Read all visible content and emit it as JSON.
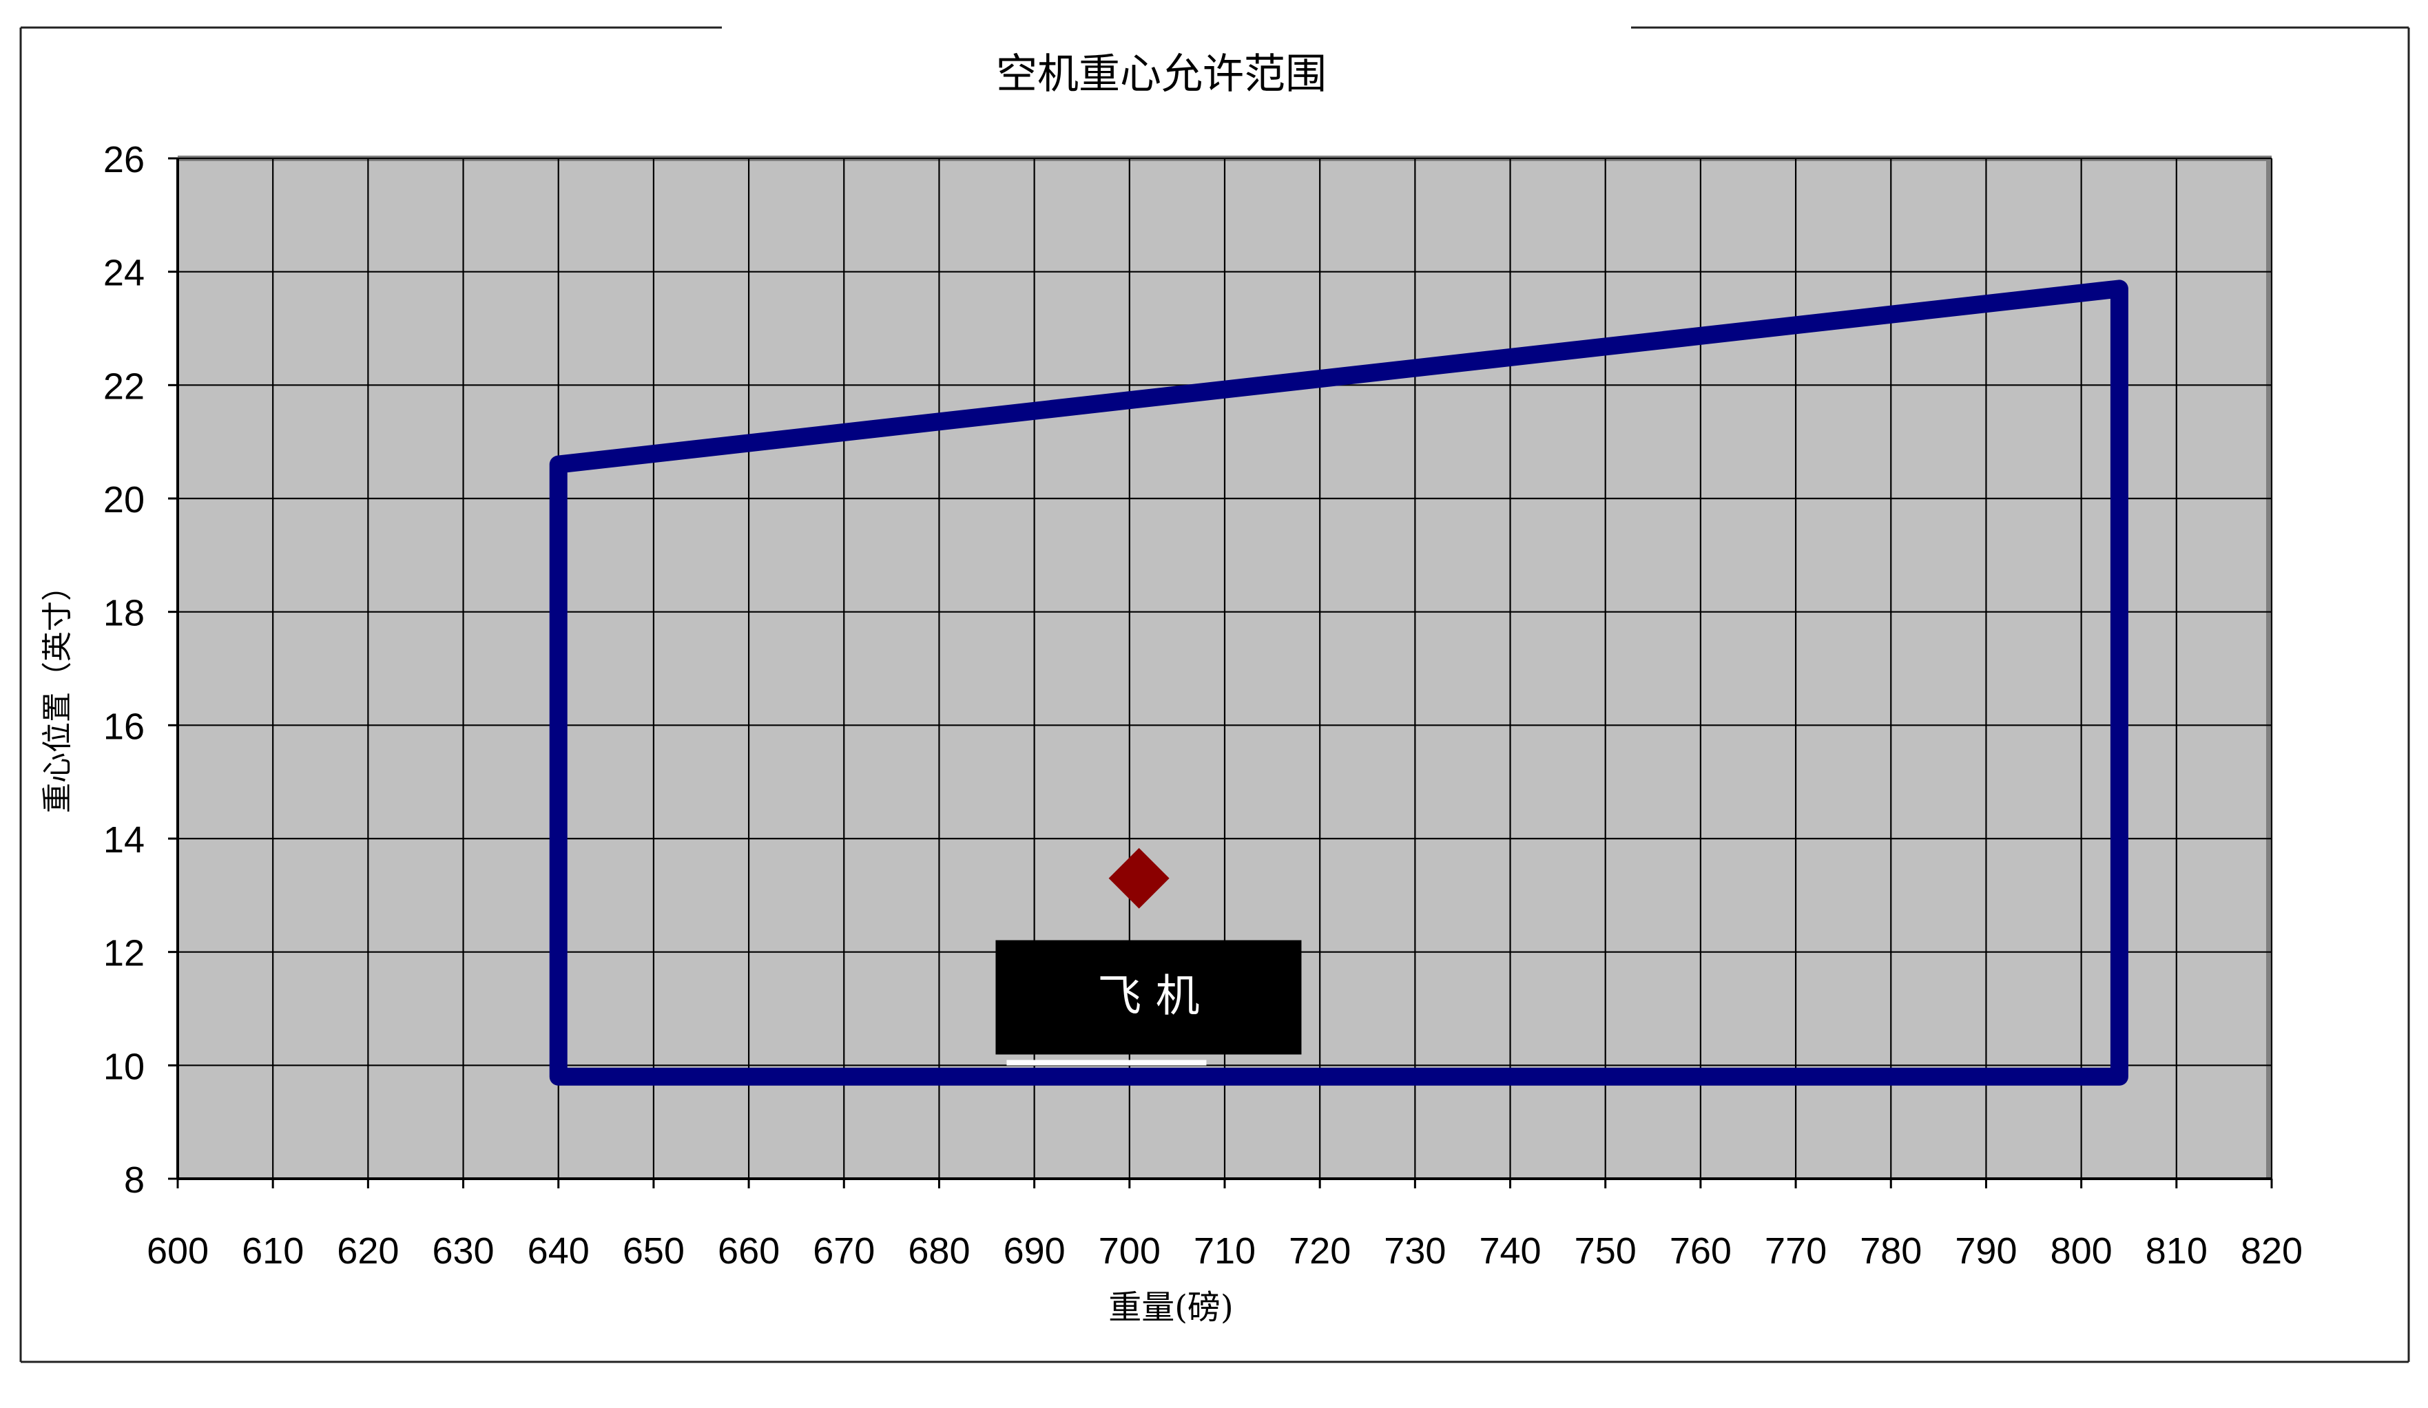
{
  "chart_data": {
    "type": "line",
    "title": "空机重心允许范围",
    "xlabel": "重量(磅)",
    "ylabel": "重心位置（英寸）",
    "xlim": [
      600,
      820
    ],
    "ylim": [
      8,
      26
    ],
    "x_ticks": [
      600,
      610,
      620,
      630,
      640,
      650,
      660,
      670,
      680,
      690,
      700,
      710,
      720,
      730,
      740,
      750,
      760,
      770,
      780,
      790,
      800,
      810,
      820
    ],
    "y_ticks": [
      8,
      10,
      12,
      14,
      16,
      18,
      20,
      22,
      24,
      26
    ],
    "grid": true,
    "series": [
      {
        "type": "line",
        "color": "#000080",
        "points": [
          {
            "x": 640,
            "y": 20.6
          },
          {
            "x": 804,
            "y": 23.7
          },
          {
            "x": 804,
            "y": 9.8
          },
          {
            "x": 640,
            "y": 9.8
          },
          {
            "x": 640,
            "y": 20.6
          }
        ]
      },
      {
        "type": "scatter",
        "marker": "diamond",
        "color": "#8b0000",
        "points": [
          {
            "x": 701,
            "y": 13.3
          }
        ]
      }
    ],
    "annotations": [
      {
        "text": "飞 机",
        "at_x": 702,
        "at_y": 11.2
      }
    ],
    "colors": {
      "plot_bg": "#c0c0c0",
      "grid": "#000000",
      "envelope": "#000080",
      "marker": "#8b0000",
      "label_box": "#000000",
      "label_text": "#ffffff"
    }
  }
}
